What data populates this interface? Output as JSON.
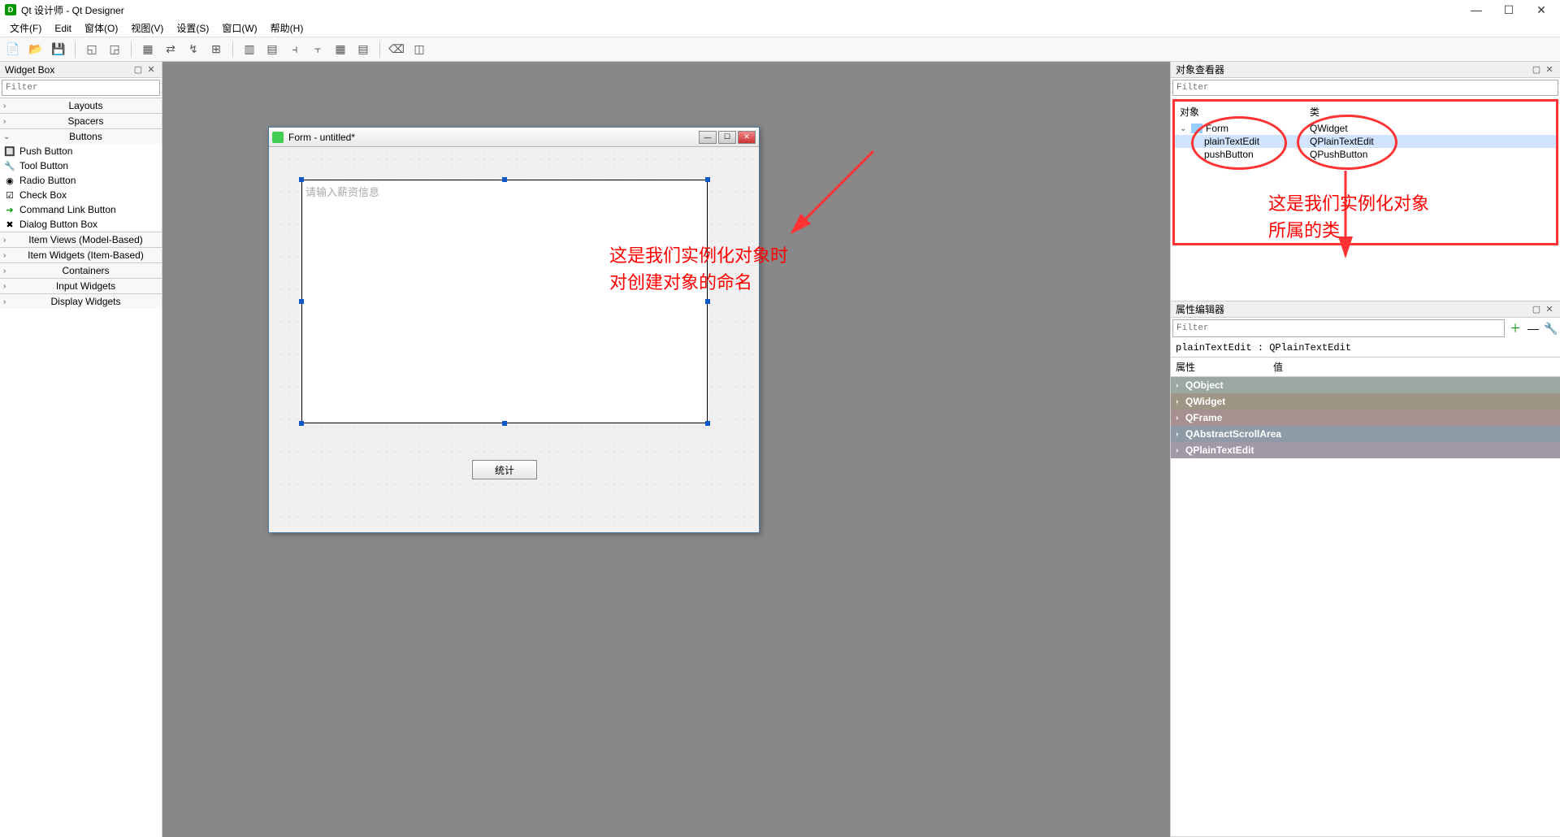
{
  "app": {
    "title": "Qt 设计师 - Qt Designer"
  },
  "menu": {
    "file": "文件(F)",
    "edit": "Edit",
    "form": "窗体(O)",
    "view": "视图(V)",
    "settings": "设置(S)",
    "window": "窗口(W)",
    "help": "帮助(H)"
  },
  "widget_box": {
    "title": "Widget Box",
    "filter_placeholder": "Filter",
    "groups": {
      "layouts": "Layouts",
      "spacers": "Spacers",
      "buttons": "Buttons",
      "item_views": "Item Views (Model-Based)",
      "item_widgets": "Item Widgets (Item-Based)",
      "containers": "Containers",
      "input_widgets": "Input Widgets",
      "display_widgets": "Display Widgets"
    },
    "buttons_items": {
      "push_button": "Push Button",
      "tool_button": "Tool Button",
      "radio_button": "Radio Button",
      "check_box": "Check Box",
      "command_link": "Command Link Button",
      "dialog_box": "Dialog Button Box"
    }
  },
  "form": {
    "title": "Form - untitled*",
    "placeholder": "请输入薪资信息",
    "button_text": "统计"
  },
  "annotations": {
    "left_line1": "这是我们实例化对象时",
    "left_line2": "对创建对象的命名",
    "right_line1": "这是我们实例化对象",
    "right_line2": "所属的类"
  },
  "object_inspector": {
    "title": "对象查看器",
    "filter_placeholder": "Filter",
    "col_object": "对象",
    "col_class": "类",
    "rows": [
      {
        "name": "Form",
        "class": "QWidget"
      },
      {
        "name": "plainTextEdit",
        "class": "QPlainTextEdit"
      },
      {
        "name": "pushButton",
        "class": "QPushButton"
      }
    ]
  },
  "property_editor": {
    "title": "属性编辑器",
    "filter_placeholder": "Filter",
    "object_label": "plainTextEdit : QPlainTextEdit",
    "col_prop": "属性",
    "col_value": "值",
    "groups": [
      "QObject",
      "QWidget",
      "QFrame",
      "QAbstractScrollArea",
      "QPlainTextEdit"
    ]
  }
}
